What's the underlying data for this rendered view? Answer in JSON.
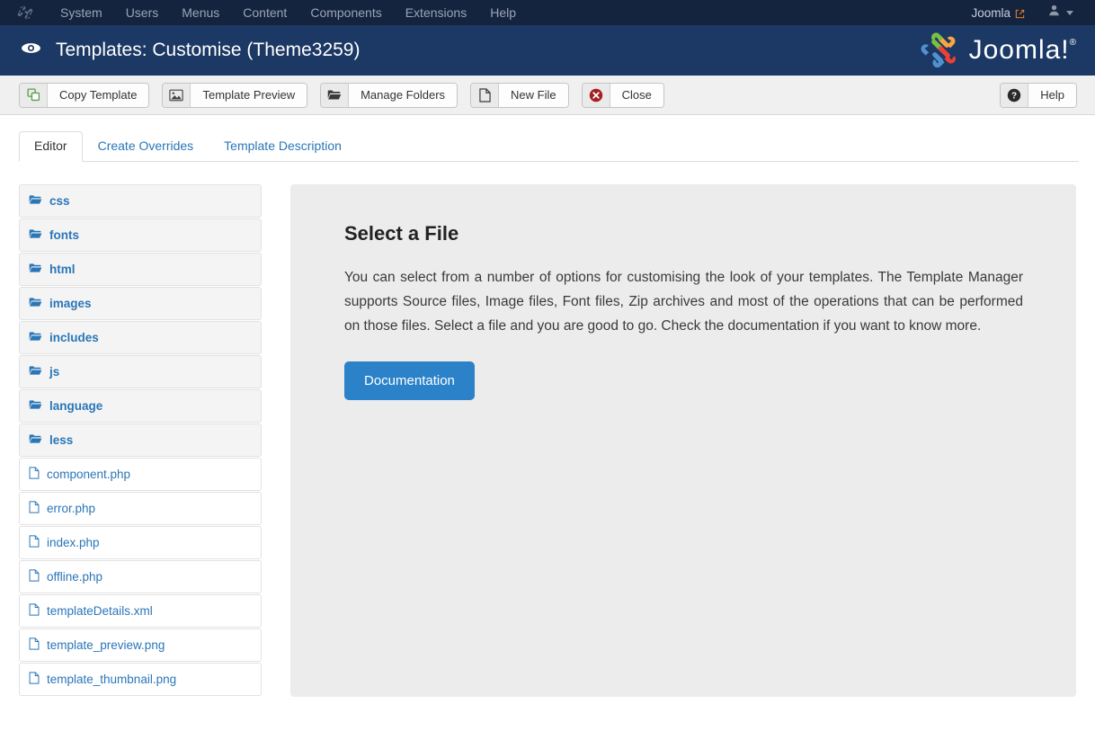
{
  "topnav": {
    "brand_icon": "joomla-mark-icon",
    "items": [
      {
        "label": "System"
      },
      {
        "label": "Users"
      },
      {
        "label": "Menus"
      },
      {
        "label": "Content"
      },
      {
        "label": "Components"
      },
      {
        "label": "Extensions"
      },
      {
        "label": "Help"
      }
    ],
    "site_label": "Joomla",
    "site_icon": "external-link-icon",
    "user_icon": "user-icon",
    "user_caret": "chevron-down-icon",
    "background_color": "#14243f",
    "text_color": "#9aa4b4"
  },
  "header": {
    "icon": "eye-icon",
    "title": "Templates: Customise (Theme3259)",
    "logo_text": "Joomla!",
    "logo_registered": "®",
    "background_color": "#1c3864"
  },
  "toolbar": {
    "buttons": [
      {
        "label": "Copy Template",
        "icon": "copy-icon"
      },
      {
        "label": "Template Preview",
        "icon": "image-icon"
      },
      {
        "label": "Manage Folders",
        "icon": "folder-icon"
      },
      {
        "label": "New File",
        "icon": "file-icon"
      },
      {
        "label": "Close",
        "icon": "close-circle-icon"
      }
    ],
    "help": {
      "label": "Help",
      "icon": "question-circle-icon"
    }
  },
  "tabs": [
    {
      "label": "Editor",
      "active": true
    },
    {
      "label": "Create Overrides",
      "active": false
    },
    {
      "label": "Template Description",
      "active": false
    }
  ],
  "filelist": [
    {
      "name": "css",
      "type": "folder"
    },
    {
      "name": "fonts",
      "type": "folder"
    },
    {
      "name": "html",
      "type": "folder"
    },
    {
      "name": "images",
      "type": "folder"
    },
    {
      "name": "includes",
      "type": "folder"
    },
    {
      "name": "js",
      "type": "folder"
    },
    {
      "name": "language",
      "type": "folder"
    },
    {
      "name": "less",
      "type": "folder"
    },
    {
      "name": "component.php",
      "type": "file"
    },
    {
      "name": "error.php",
      "type": "file"
    },
    {
      "name": "index.php",
      "type": "file"
    },
    {
      "name": "offline.php",
      "type": "file"
    },
    {
      "name": "templateDetails.xml",
      "type": "file"
    },
    {
      "name": "template_preview.png",
      "type": "file"
    },
    {
      "name": "template_thumbnail.png",
      "type": "file"
    }
  ],
  "panel": {
    "heading": "Select a File",
    "body": "You can select from a number of options for customising the look of your templates. The Template Manager supports Source files, Image files, Font files, Zip archives and most of the operations that can be performed on those files. Select a file and you are good to go. Check the documentation if you want to know more.",
    "button_label": "Documentation",
    "button_color": "#2b82c8",
    "background_color": "#ececec"
  },
  "link_color": "#2a76b8"
}
